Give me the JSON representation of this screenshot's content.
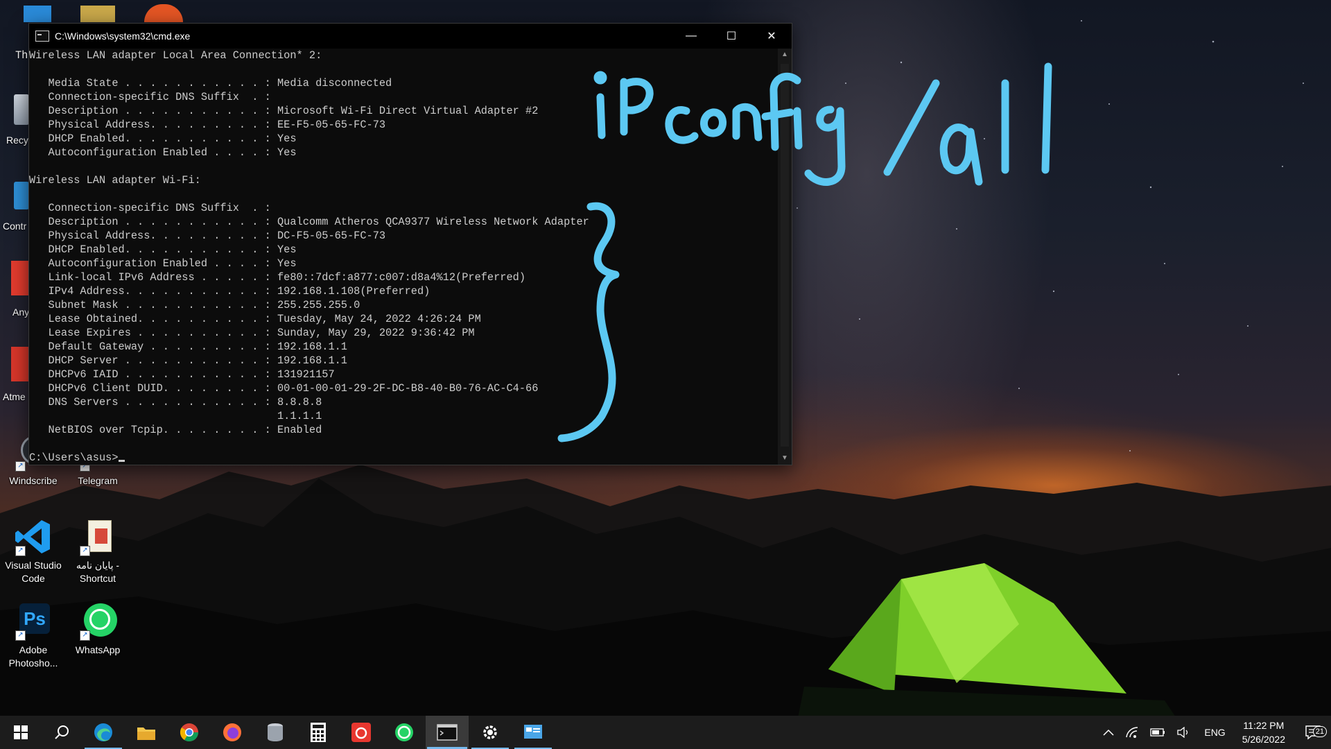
{
  "desktop": {
    "icons": [
      {
        "label": "Windscribe",
        "icon": "windscribe-icon"
      },
      {
        "label": "Telegram",
        "icon": "telegram-icon"
      },
      {
        "label": "Visual Studio Code",
        "icon": "vscode-icon"
      },
      {
        "label": "پایان نامه - Shortcut",
        "icon": "document-shortcut-icon"
      },
      {
        "label": "Adobe Photosho...",
        "icon": "photoshop-icon"
      },
      {
        "label": "WhatsApp",
        "icon": "whatsapp-icon"
      }
    ],
    "partial_labels": [
      "Recy",
      "Contr",
      "Any",
      "Atme"
    ]
  },
  "cmd_window": {
    "title": "C:\\Windows\\system32\\cmd.exe",
    "minimize": "—",
    "maximize": "☐",
    "close": "✕",
    "lines": [
      "Wireless LAN adapter Local Area Connection* 2:",
      "",
      "   Media State . . . . . . . . . . . : Media disconnected",
      "   Connection-specific DNS Suffix  . :",
      "   Description . . . . . . . . . . . : Microsoft Wi-Fi Direct Virtual Adapter #2",
      "   Physical Address. . . . . . . . . : EE-F5-05-65-FC-73",
      "   DHCP Enabled. . . . . . . . . . . : Yes",
      "   Autoconfiguration Enabled . . . . : Yes",
      "",
      "Wireless LAN adapter Wi-Fi:",
      "",
      "   Connection-specific DNS Suffix  . :",
      "   Description . . . . . . . . . . . : Qualcomm Atheros QCA9377 Wireless Network Adapter",
      "   Physical Address. . . . . . . . . : DC-F5-05-65-FC-73",
      "   DHCP Enabled. . . . . . . . . . . : Yes",
      "   Autoconfiguration Enabled . . . . : Yes",
      "   Link-local IPv6 Address . . . . . : fe80::7dcf:a877:c007:d8a4%12(Preferred)",
      "   IPv4 Address. . . . . . . . . . . : 192.168.1.108(Preferred)",
      "   Subnet Mask . . . . . . . . . . . : 255.255.255.0",
      "   Lease Obtained. . . . . . . . . . : Tuesday, May 24, 2022 4:26:24 PM",
      "   Lease Expires . . . . . . . . . . : Sunday, May 29, 2022 9:36:42 PM",
      "   Default Gateway . . . . . . . . . : 192.168.1.1",
      "   DHCP Server . . . . . . . . . . . : 192.168.1.1",
      "   DHCPv6 IAID . . . . . . . . . . . : 131921157",
      "   DHCPv6 Client DUID. . . . . . . . : 00-01-00-01-29-2F-DC-B8-40-B0-76-AC-C4-66",
      "   DNS Servers . . . . . . . . . . . : 8.8.8.8",
      "                                       1.1.1.1",
      "   NetBIOS over Tcpip. . . . . . . . : Enabled",
      ""
    ],
    "prompt": "C:\\Users\\asus>",
    "overlap_prefix": "Th"
  },
  "annotation": {
    "text": "iPconfig/all",
    "color": "#5cc8f2"
  },
  "taskbar": {
    "items": [
      {
        "name": "start",
        "icon": "windows-start-icon"
      },
      {
        "name": "search",
        "icon": "search-icon"
      },
      {
        "name": "edge",
        "icon": "edge-icon"
      },
      {
        "name": "file-explorer",
        "icon": "folder-icon"
      },
      {
        "name": "chrome",
        "icon": "chrome-icon"
      },
      {
        "name": "firefox",
        "icon": "firefox-icon"
      },
      {
        "name": "database",
        "icon": "database-icon"
      },
      {
        "name": "calculator",
        "icon": "calculator-icon"
      },
      {
        "name": "app-red",
        "icon": "red-app-icon"
      },
      {
        "name": "whatsapp",
        "icon": "whatsapp-icon"
      },
      {
        "name": "cmd",
        "icon": "terminal-icon"
      },
      {
        "name": "settings",
        "icon": "gear-icon"
      },
      {
        "name": "control-panel",
        "icon": "control-panel-icon"
      }
    ],
    "tray": {
      "language": "ENG",
      "time": "11:22 PM",
      "date": "5/26/2022",
      "notifications": "21"
    }
  }
}
